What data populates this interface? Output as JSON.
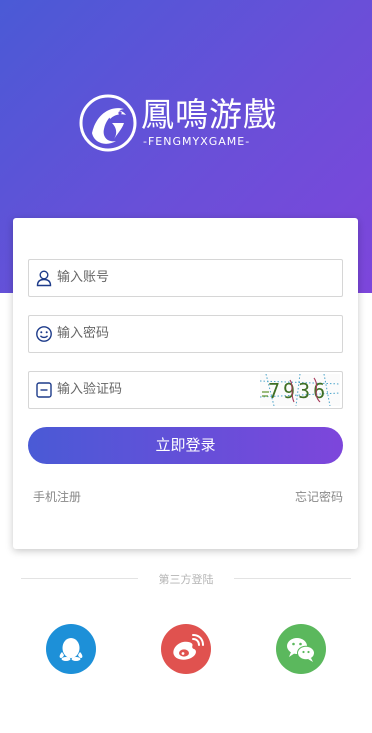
{
  "brand": {
    "title": "鳳鳴游戲",
    "subtitle": "-FENGMYXGAME-"
  },
  "form": {
    "account_placeholder": "输入账号",
    "password_placeholder": "输入密码",
    "captcha_placeholder": "输入验证码",
    "captcha_text": "7936",
    "login_label": "立即登录",
    "register_link": "手机注册",
    "forgot_link": "忘记密码",
    "icons": {
      "account": "user-icon",
      "password": "smile-icon",
      "captcha": "minus-square-icon"
    }
  },
  "third_party": {
    "label": "第三方登陆",
    "providers": [
      {
        "icon": "qq-icon",
        "color": "#1d90d8"
      },
      {
        "icon": "weibo-icon",
        "color": "#e0524f"
      },
      {
        "icon": "wechat-icon",
        "color": "#5bb85d"
      }
    ]
  },
  "colors": {
    "gradient_start": "#4a5ad6",
    "gradient_end": "#7d46db"
  }
}
